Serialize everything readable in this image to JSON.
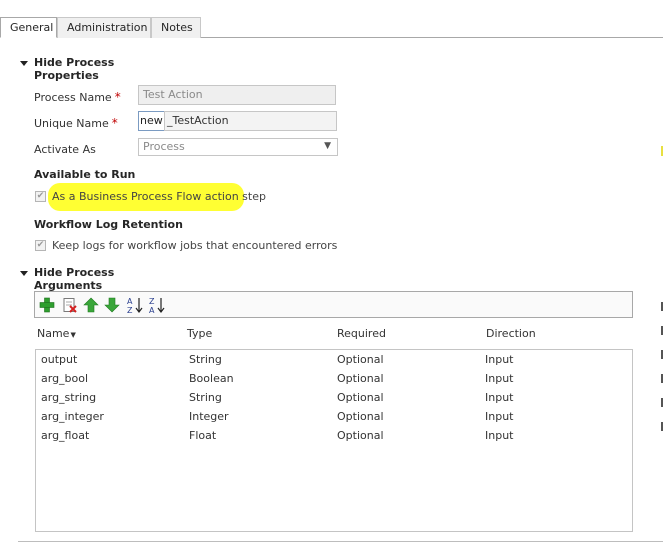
{
  "tabs": [
    {
      "label": "General",
      "active": true
    },
    {
      "label": "Administration",
      "active": false
    },
    {
      "label": "Notes",
      "active": false
    }
  ],
  "process_properties": {
    "header": "Hide Process Properties",
    "process_name_label": "Process Name",
    "process_name_value": "Test Action",
    "unique_name_label": "Unique Name",
    "unique_name_prefix": "new",
    "unique_name_value": "_TestAction",
    "activate_as_label": "Activate As",
    "activate_as_value": "Process",
    "required_marker": "*",
    "available_to_run_label": "Available to Run",
    "bpf_checkbox_label": "As a Business Process Flow action step",
    "bpf_checked": true,
    "log_retention_label": "Workflow Log Retention",
    "keep_logs_label": "Keep logs for workflow jobs that encountered errors",
    "keep_logs_checked": true
  },
  "process_arguments": {
    "header": "Hide Process Arguments",
    "toolbar_icons": [
      "add-icon",
      "delete-icon",
      "move-up-icon",
      "move-down-icon",
      "sort-ascending-icon",
      "sort-descending-icon"
    ],
    "columns": [
      "Name",
      "Type",
      "Required",
      "Direction"
    ],
    "rows": [
      {
        "name": "output",
        "type": "String",
        "required": "Optional",
        "direction": "Input"
      },
      {
        "name": "arg_bool",
        "type": "Boolean",
        "required": "Optional",
        "direction": "Input"
      },
      {
        "name": "arg_string",
        "type": "String",
        "required": "Optional",
        "direction": "Input"
      },
      {
        "name": "arg_integer",
        "type": "Integer",
        "required": "Optional",
        "direction": "Input"
      },
      {
        "name": "arg_float",
        "type": "Float",
        "required": "Optional",
        "direction": "Input"
      }
    ]
  },
  "colors": {
    "highlight": "#ffff33",
    "required": "#c00000",
    "add_icon": "#2e9e2e",
    "arrow_icon": "#3aa63a"
  }
}
